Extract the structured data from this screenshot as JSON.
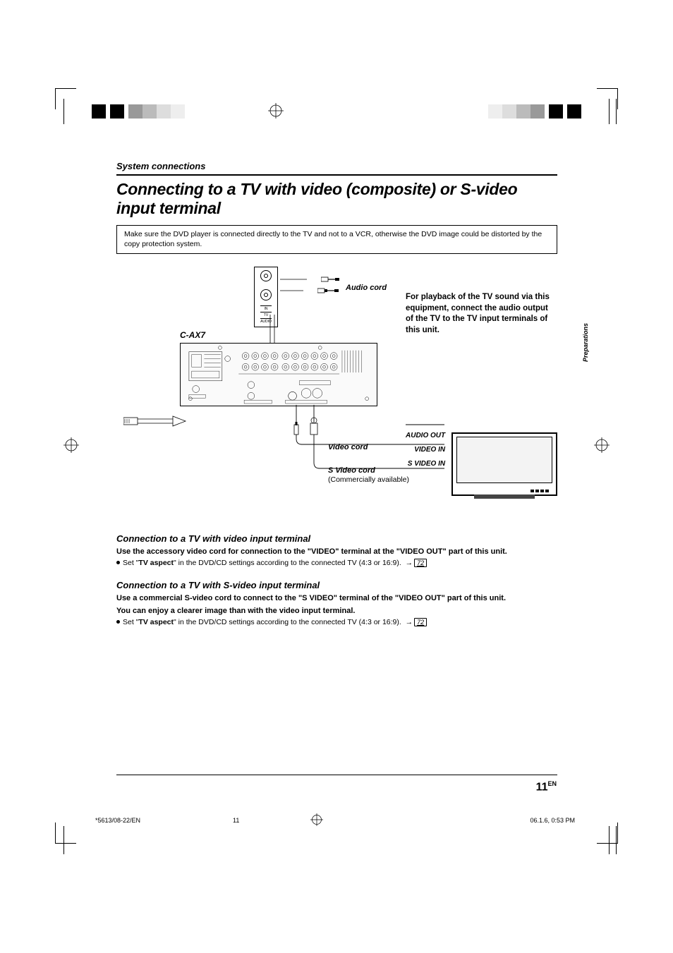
{
  "breadcrumb": "System connections",
  "title": "Connecting to a TV with video (composite) or S-video input terminal",
  "note": "Make sure the DVD player is connected directly to the TV and not to a VCR, otherwise the DVD image could be distorted by the copy protection system.",
  "side_tab": "Preparations",
  "diagram": {
    "model": "C-AX7",
    "audio_cord": "Audio cord",
    "video_cord": "Video cord",
    "svideo_cord": "S Video cord",
    "commercial": "(Commercially available)",
    "info": "For playback of the TV sound via this equipment, connect the audio output of the TV to the TV input terminals of this unit.",
    "tv_ports": {
      "audio": "AUDIO OUT",
      "video": "VIDEO IN",
      "svideo": "S VIDEO IN"
    },
    "jack_box": {
      "in": "IN",
      "tv": "TV",
      "audio": "AUDIO"
    }
  },
  "section1": {
    "heading": "Connection to a TV with video input terminal",
    "para": "Use the accessory video cord for connection to the \"VIDEO\" terminal at the \"VIDEO OUT\" part of this unit.",
    "bullet_a": "Set \"",
    "bullet_b": "TV aspect",
    "bullet_c": "\" in the DVD/CD settings according to the connected TV (4:3 or 16:9).",
    "page_ref": "72"
  },
  "section2": {
    "heading": "Connection to a TV with S-video input terminal",
    "para1": "Use a commercial S-video cord to connect to the \"S VIDEO\" terminal of the \"VIDEO OUT\" part of this unit.",
    "para2": "You can enjoy a clearer image than with the video input terminal.",
    "bullet_a": "Set \"",
    "bullet_b": "TV aspect",
    "bullet_c": "\" in the DVD/CD settings according to the connected TV (4:3 or 16:9).",
    "page_ref": "72"
  },
  "page_number": "11",
  "page_lang": "EN",
  "footer": {
    "left": "*5613/08-22/EN",
    "mid": "11",
    "right": "06.1.6, 0:53 PM"
  }
}
